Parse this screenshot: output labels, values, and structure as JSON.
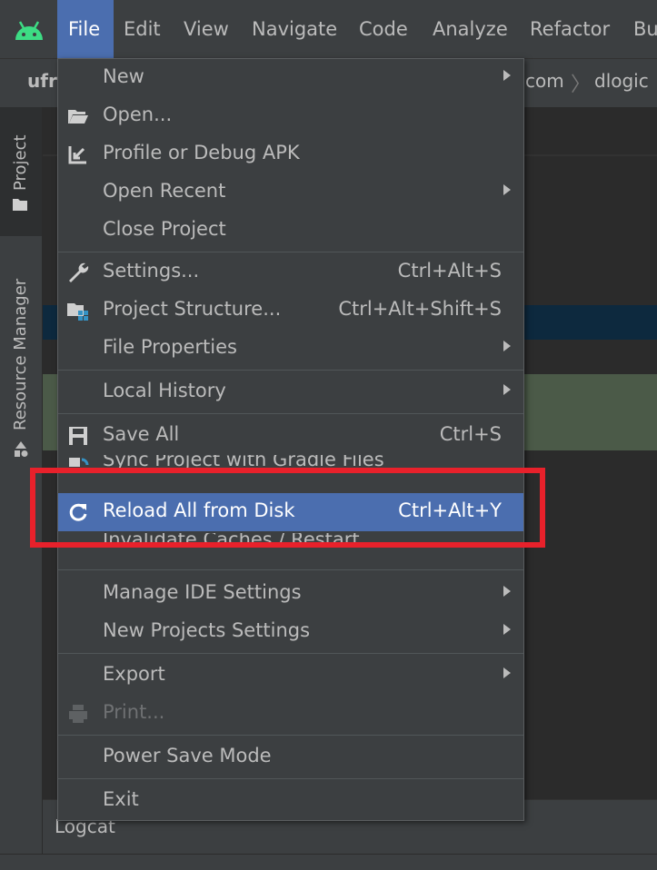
{
  "menubar": {
    "items": [
      "File",
      "Edit",
      "View",
      "Navigate",
      "Code",
      "Analyze",
      "Refactor",
      "Bu"
    ]
  },
  "navbar": {
    "project": "ufr",
    "crumbs": [
      "com",
      "dlogic"
    ]
  },
  "left_tabs": {
    "project": "Project",
    "resource_manager": "Resource Manager"
  },
  "bottom": {
    "logcat": "Logcat"
  },
  "file_menu": {
    "new": "New",
    "open": "Open...",
    "profile_debug": "Profile or Debug APK",
    "open_recent": "Open Recent",
    "close_project": "Close Project",
    "settings": "Settings...",
    "settings_sc": "Ctrl+Alt+S",
    "project_structure": "Project Structure...",
    "project_structure_sc": "Ctrl+Alt+Shift+S",
    "file_properties": "File Properties",
    "local_history": "Local History",
    "save_all": "Save All",
    "save_all_sc": "Ctrl+S",
    "sync_gradle": "Sync Project with Gradle Files",
    "reload_disk": "Reload All from Disk",
    "reload_disk_sc": "Ctrl+Alt+Y",
    "invalidate": "Invalidate Caches / Restart...",
    "manage_ide": "Manage IDE Settings",
    "new_projects_settings": "New Projects Settings",
    "export": "Export",
    "print": "Print...",
    "power_save": "Power Save Mode",
    "exit": "Exit"
  },
  "colors": {
    "highlight": "#4b6eaf",
    "annotation": "#e8212b",
    "android_green": "#3ddc84"
  }
}
